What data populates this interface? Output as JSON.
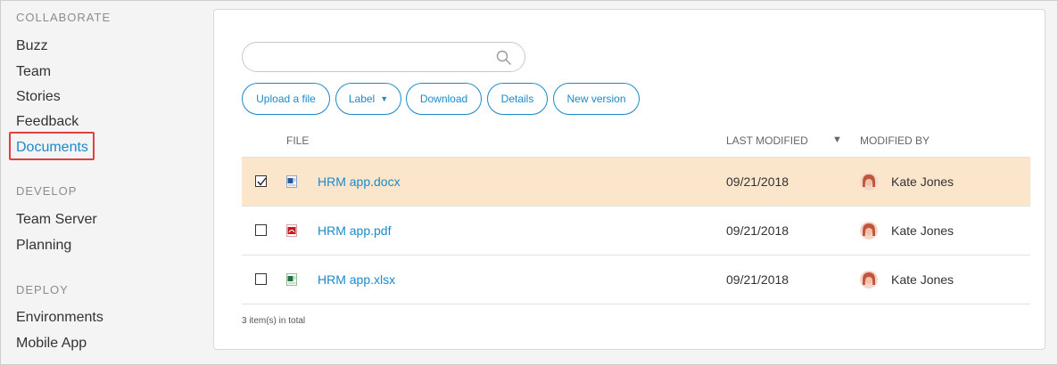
{
  "sidebar": {
    "sections": [
      {
        "title": "COLLABORATE",
        "items": [
          "Buzz",
          "Team",
          "Stories",
          "Feedback",
          "Documents"
        ]
      },
      {
        "title": "DEVELOP",
        "items": [
          "Team Server",
          "Planning"
        ]
      },
      {
        "title": "DEPLOY",
        "items": [
          "Environments",
          "Mobile App"
        ]
      }
    ],
    "active_item": "Documents"
  },
  "search": {
    "value": "",
    "placeholder": ""
  },
  "toolbar": {
    "upload": "Upload a file",
    "label": "Label",
    "download": "Download",
    "details": "Details",
    "new_version": "New version"
  },
  "table": {
    "headers": {
      "file": "FILE",
      "modified": "LAST MODIFIED",
      "modified_by": "MODIFIED BY"
    },
    "rows": [
      {
        "name": "HRM app.docx",
        "date": "09/21/2018",
        "user": "Kate Jones",
        "checked": true,
        "icon": "word-file-icon"
      },
      {
        "name": "HRM app.pdf",
        "date": "09/21/2018",
        "user": "Kate Jones",
        "checked": false,
        "icon": "pdf-file-icon"
      },
      {
        "name": "HRM app.xlsx",
        "date": "09/21/2018",
        "user": "Kate Jones",
        "checked": false,
        "icon": "excel-file-icon"
      }
    ],
    "total": "3 item(s) in total"
  },
  "colors": {
    "accent": "#1a8ac9",
    "selected_row": "#fbe6cc",
    "highlight_box": "#e04040"
  }
}
